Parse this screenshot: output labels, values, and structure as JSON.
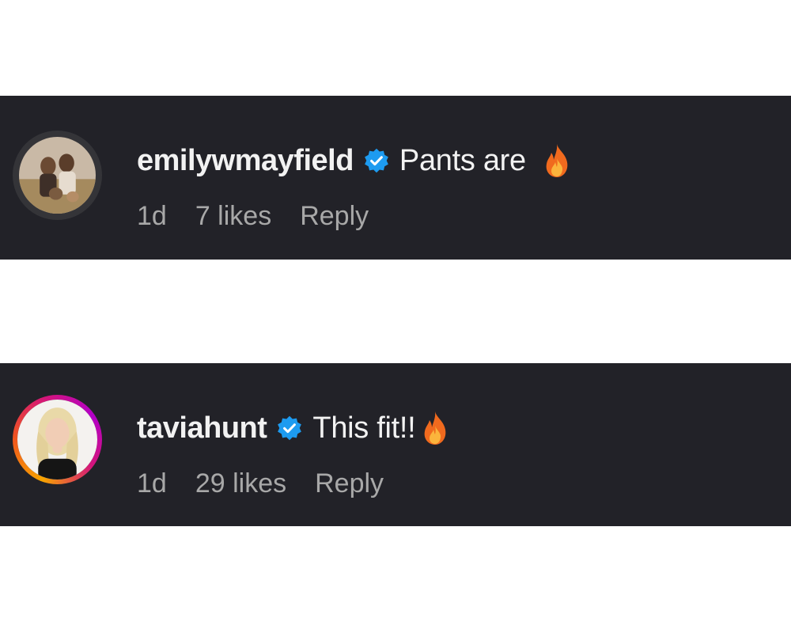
{
  "comments": [
    {
      "username": "emilywmayfield",
      "verified": true,
      "text": "Pants are",
      "emoji": "fire-icon",
      "time": "1d",
      "likes": "7 likes",
      "reply_label": "Reply",
      "story_ring": false
    },
    {
      "username": "taviahunt",
      "verified": true,
      "text": "This fit!!",
      "emoji": "fire-icon",
      "time": "1d",
      "likes": "29 likes",
      "reply_label": "Reply",
      "story_ring": true
    }
  ],
  "colors": {
    "background": "#ffffff",
    "comment_bg": "#222228",
    "username": "#f2f2f2",
    "meta": "#a8a8a8",
    "verified": "#1d9bf0"
  }
}
